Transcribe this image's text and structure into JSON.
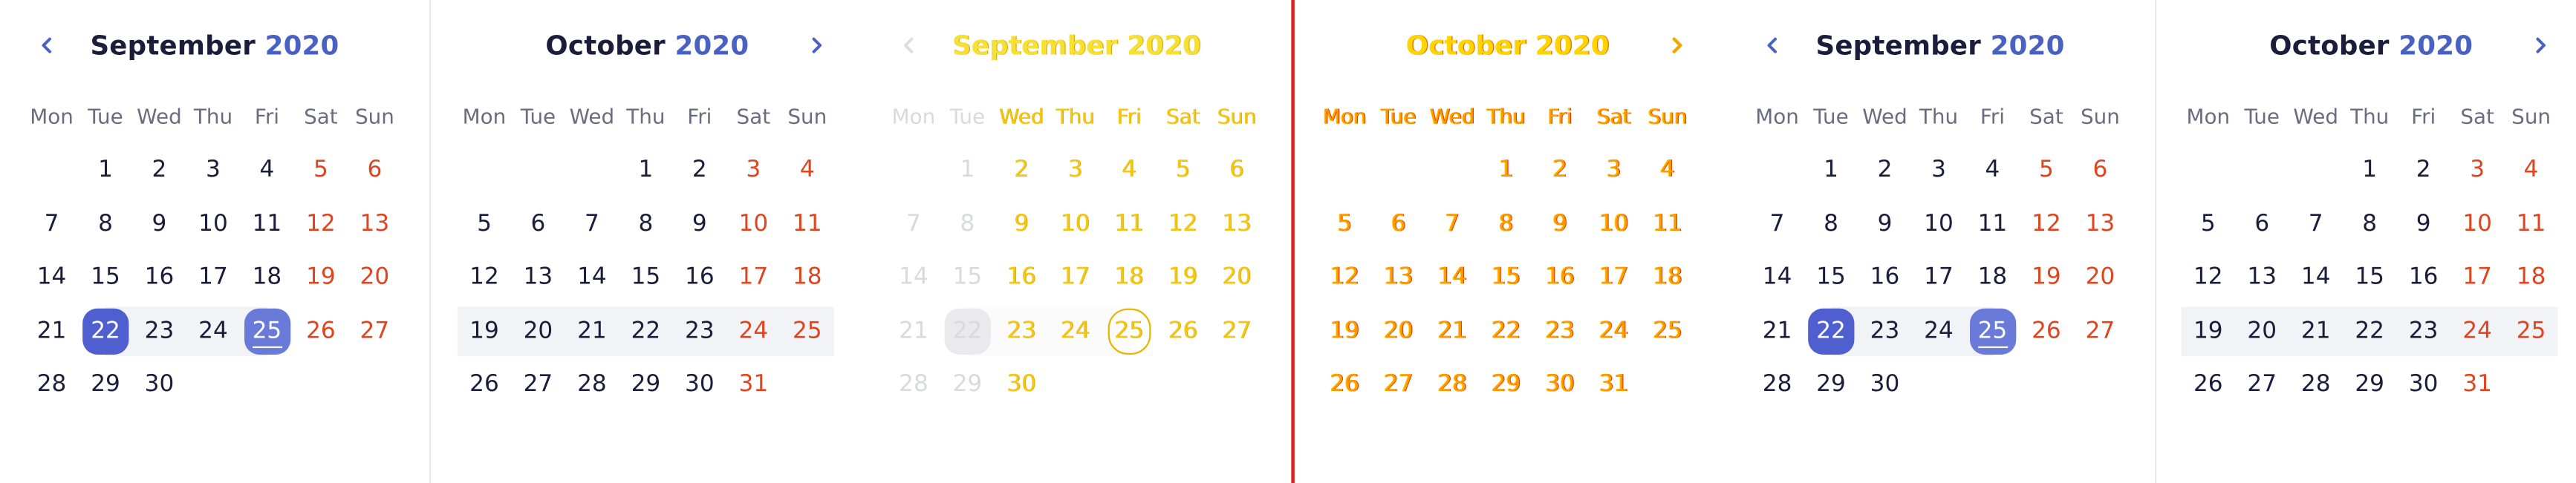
{
  "weekdays": [
    "Mon",
    "Tue",
    "Wed",
    "Thu",
    "Fri",
    "Sat",
    "Sun"
  ],
  "panel1": {
    "month": "September",
    "year": "2020",
    "prev_icon": "chevron-left-icon",
    "days": [
      "1",
      "2",
      "3",
      "4",
      "5",
      "6",
      "7",
      "8",
      "9",
      "10",
      "11",
      "12",
      "13",
      "14",
      "15",
      "16",
      "17",
      "18",
      "19",
      "20",
      "21",
      "22",
      "23",
      "24",
      "25",
      "26",
      "27",
      "28",
      "29",
      "30"
    ]
  },
  "panel2": {
    "month": "October",
    "year": "2020",
    "next_icon": "chevron-right-icon",
    "days": [
      "1",
      "2",
      "3",
      "4",
      "5",
      "6",
      "7",
      "8",
      "9",
      "10",
      "11",
      "12",
      "13",
      "14",
      "15",
      "16",
      "17",
      "18",
      "19",
      "20",
      "21",
      "22",
      "23",
      "24",
      "25",
      "26",
      "27",
      "28",
      "29",
      "30",
      "31"
    ]
  },
  "panel3": {
    "month": "September",
    "year": "2020",
    "prev_icon": "chevron-left-icon",
    "days": [
      "1",
      "2",
      "3",
      "4",
      "5",
      "6",
      "7",
      "8",
      "9",
      "10",
      "11",
      "12",
      "13",
      "14",
      "15",
      "16",
      "17",
      "18",
      "19",
      "20",
      "21",
      "22",
      "23",
      "24",
      "25",
      "26",
      "27",
      "28",
      "29",
      "30"
    ]
  },
  "panel4": {
    "month": "October",
    "year": "2020",
    "next_icon": "chevron-right-icon",
    "days": [
      "1",
      "2",
      "3",
      "4",
      "5",
      "6",
      "7",
      "8",
      "9",
      "10",
      "11",
      "12",
      "13",
      "14",
      "15",
      "16",
      "17",
      "18",
      "19",
      "20",
      "21",
      "22",
      "23",
      "24",
      "25",
      "26",
      "27",
      "28",
      "29",
      "30",
      "31"
    ]
  },
  "panel5": {
    "month": "September",
    "year": "2020",
    "prev_icon": "chevron-left-icon",
    "days": [
      "1",
      "2",
      "3",
      "4",
      "5",
      "6",
      "7",
      "8",
      "9",
      "10",
      "11",
      "12",
      "13",
      "14",
      "15",
      "16",
      "17",
      "18",
      "19",
      "20",
      "21",
      "22",
      "23",
      "24",
      "25",
      "26",
      "27",
      "28",
      "29",
      "30"
    ]
  },
  "panel6": {
    "month": "October",
    "year": "2020",
    "next_icon": "chevron-right-icon",
    "days": [
      "1",
      "2",
      "3",
      "4",
      "5",
      "6",
      "7",
      "8",
      "9",
      "10",
      "11",
      "12",
      "13",
      "14",
      "15",
      "16",
      "17",
      "18",
      "19",
      "20",
      "21",
      "22",
      "23",
      "24",
      "25",
      "26",
      "27",
      "28",
      "29",
      "30",
      "31"
    ]
  },
  "selection": {
    "start_day": "22",
    "end_day": "25",
    "month": "September",
    "year": "2020"
  },
  "colors": {
    "accent": "#4f5fd0",
    "weekend": "#e0451f",
    "divider": "#e0201c"
  }
}
